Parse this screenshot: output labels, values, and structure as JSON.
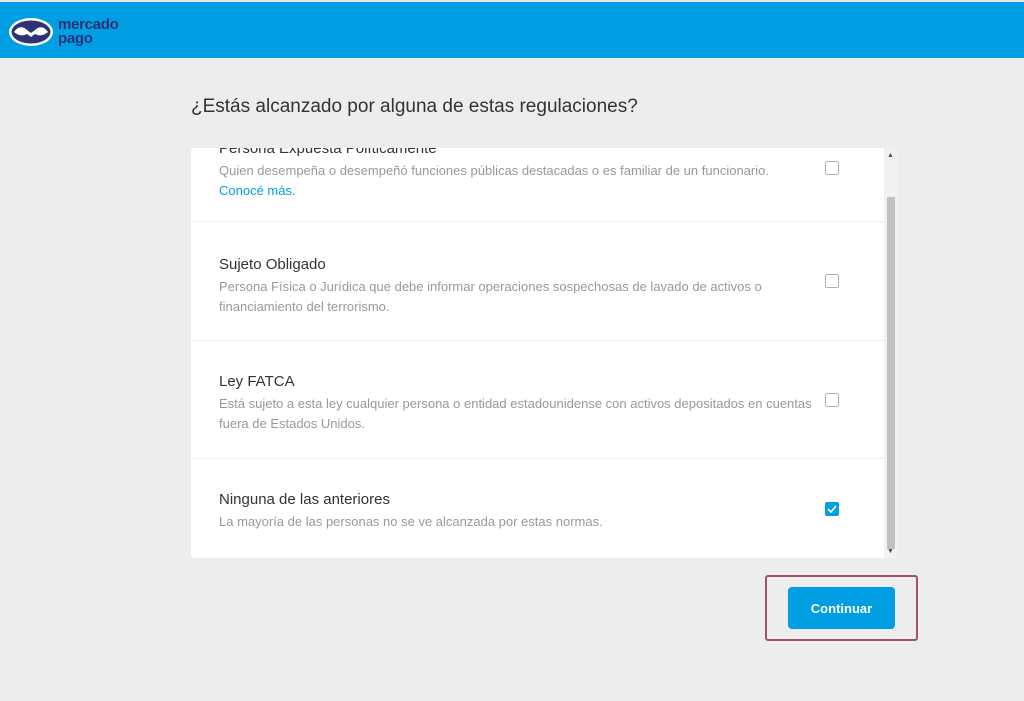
{
  "header": {
    "logo_line1": "mercado",
    "logo_line2": "pago",
    "bg_color": "#009ee3"
  },
  "title": "¿Estás alcanzado por alguna de estas regulaciones?",
  "options": [
    {
      "title": "Persona Expuesta Políticamente",
      "description": "Quien desempeña o desempeñó funciones públicas destacadas o es familiar de un funcionario.",
      "link": "Conocé más.",
      "checked": false
    },
    {
      "title": "Sujeto Obligado",
      "description": "Persona Física o Jurídica que debe informar operaciones sospechosas de lavado de activos o financiamiento del terrorismo.",
      "checked": false
    },
    {
      "title": "Ley FATCA",
      "description": "Está sujeto a esta ley cualquier persona o entidad estadounidense con activos depositados en cuentas fuera de Estados Unidos.",
      "checked": false
    },
    {
      "title": "Ninguna de las anteriores",
      "description": "La mayoría de las personas no se ve alcanzada por estas normas.",
      "checked": true
    }
  ],
  "continue_label": "Continuar",
  "icons": {
    "logo": "mercado-pago-handshake-icon",
    "check": "check-icon",
    "scroll_up": "scroll-up-arrow-icon",
    "scroll_down": "scroll-down-arrow-icon"
  }
}
